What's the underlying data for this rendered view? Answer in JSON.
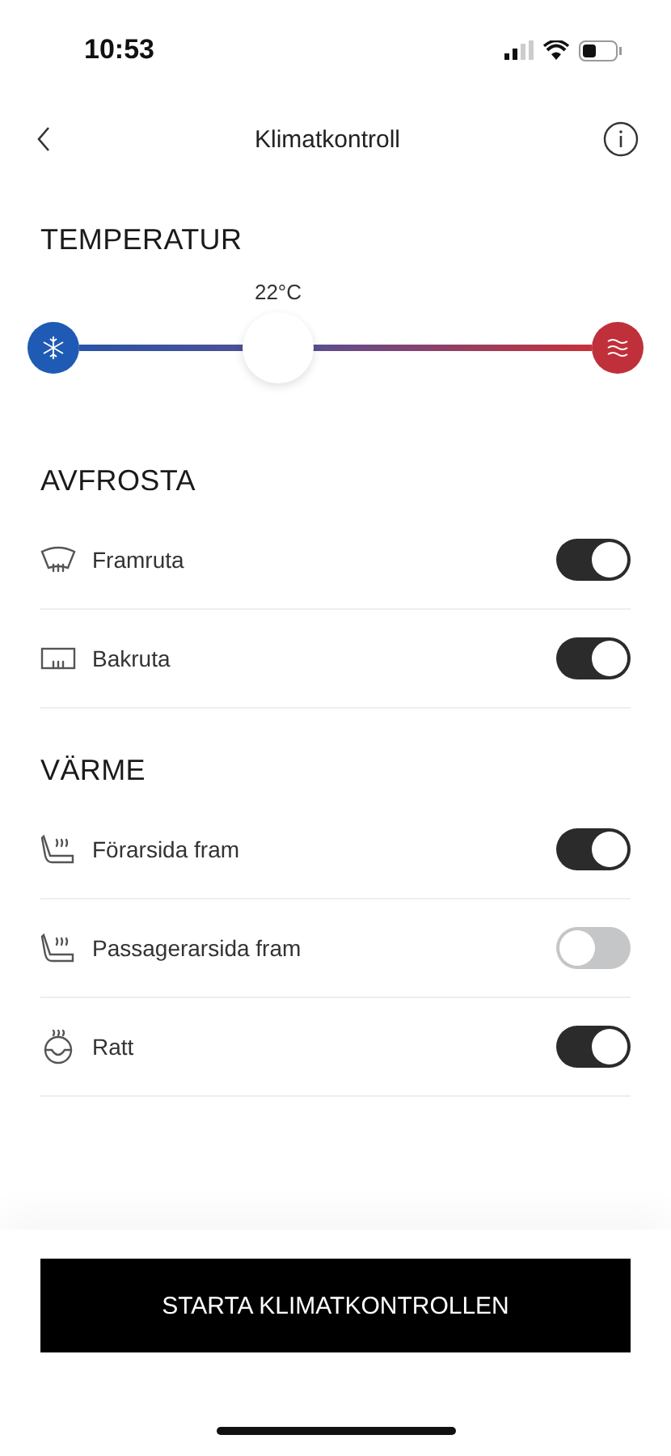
{
  "status_bar": {
    "time": "10:53"
  },
  "nav": {
    "title": "Klimatkontroll"
  },
  "temperature": {
    "heading": "TEMPERATUR",
    "reading": "22°C",
    "level": 0.37
  },
  "sections": [
    {
      "heading": "AVFROSTA",
      "items": [
        {
          "kind": "windshield",
          "label": "Framruta",
          "on": true
        },
        {
          "kind": "rear-window",
          "label": "Bakruta",
          "on": true
        }
      ]
    },
    {
      "heading": "VÄRME",
      "items": [
        {
          "kind": "seat",
          "label": "Förarsida fram",
          "on": true
        },
        {
          "kind": "seat",
          "label": "Passagerarsida fram",
          "on": false
        },
        {
          "kind": "steering-wheel",
          "label": "Ratt",
          "on": true
        }
      ]
    }
  ],
  "action": {
    "label": "STARTA KLIMATKONTROLLEN"
  }
}
